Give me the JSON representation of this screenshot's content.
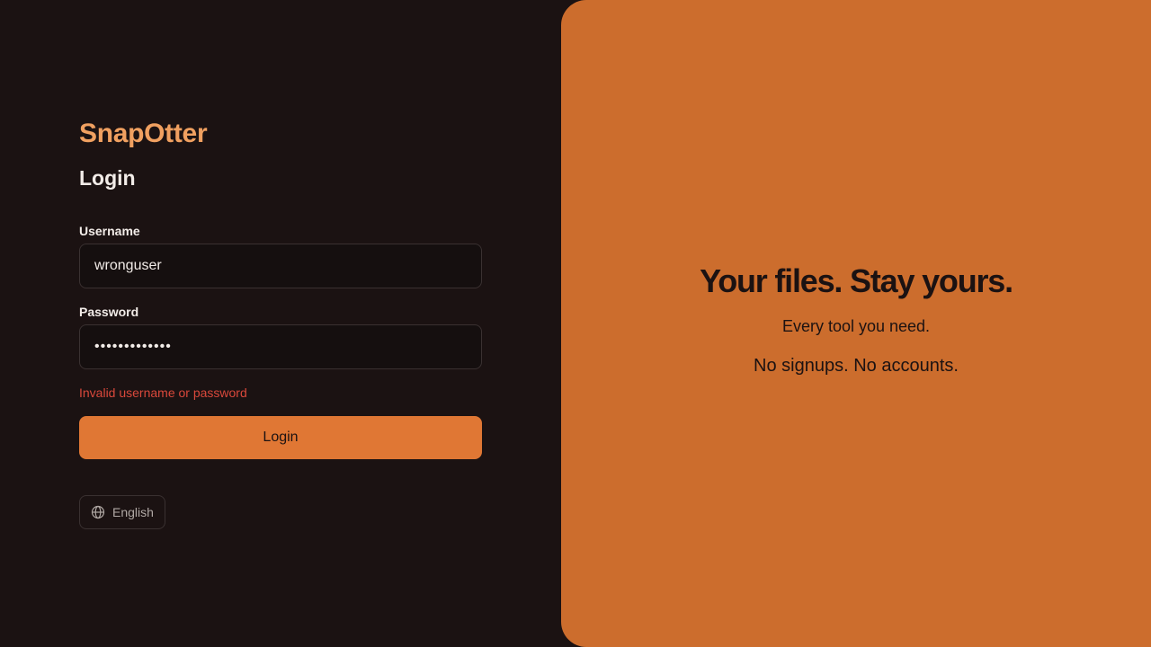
{
  "brand": {
    "name": "SnapOtter"
  },
  "form": {
    "title": "Login",
    "username": {
      "label": "Username",
      "value": "wronguser"
    },
    "password": {
      "label": "Password",
      "value": "•••••••••••••"
    },
    "error": "Invalid username or password",
    "submit_label": "Login"
  },
  "language": {
    "icon": "globe-icon",
    "label": "English"
  },
  "hero": {
    "title": "Your files. Stay yours.",
    "subtitle": "Every tool you need.",
    "tagline": "No signups. No accounts."
  },
  "colors": {
    "background": "#1b1212",
    "brand": "#f0a060",
    "accent": "#e07734",
    "panel": "#cc6d2d",
    "error": "#d9483b"
  }
}
